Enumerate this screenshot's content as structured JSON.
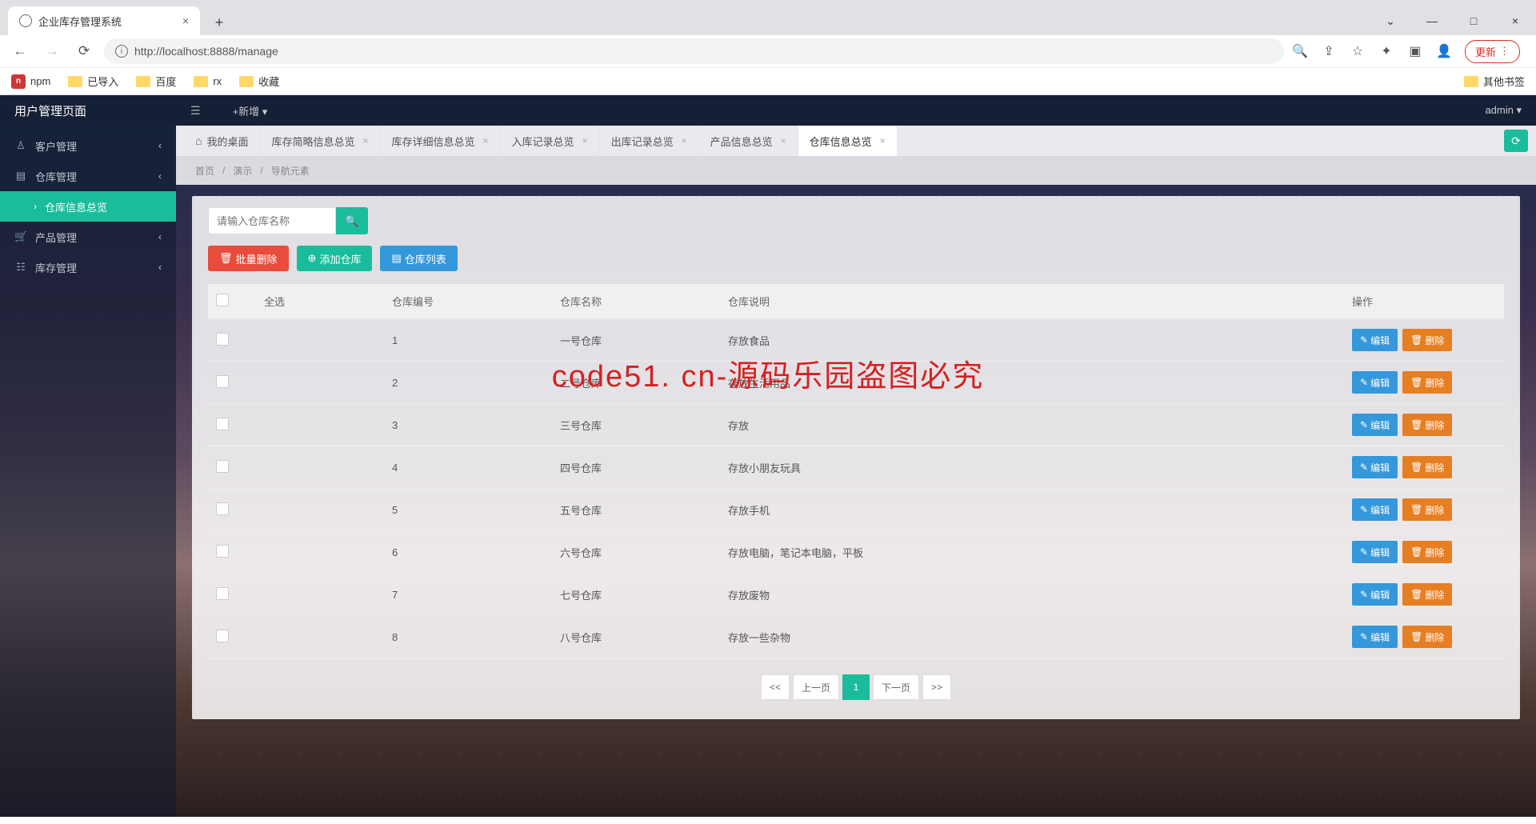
{
  "browser": {
    "tab_title": "企业库存管理系统",
    "url": "http://localhost:8888/manage",
    "update_label": "更新",
    "bookmarks": [
      {
        "label": "npm",
        "color": "#cb3837"
      },
      {
        "label": "已导入",
        "folder": true
      },
      {
        "label": "百度",
        "folder": true
      },
      {
        "label": "rx",
        "folder": true
      },
      {
        "label": "收藏",
        "folder": true
      }
    ],
    "other_bookmarks": "其他书签",
    "win": {
      "restore_down": "v"
    }
  },
  "app": {
    "title": "用户管理页面",
    "add_new": "+新增",
    "user": "admin"
  },
  "sidebar": {
    "items": [
      {
        "icon": "user-icon",
        "label": "客户管理"
      },
      {
        "icon": "warehouse-icon",
        "label": "仓库管理",
        "expanded": true
      },
      {
        "icon": "product-icon",
        "label": "产品管理"
      },
      {
        "icon": "inventory-icon",
        "label": "库存管理"
      }
    ],
    "sub_item": "仓库信息总览"
  },
  "tabs": [
    {
      "label": "我的桌面",
      "home": true
    },
    {
      "label": "库存简略信息总览"
    },
    {
      "label": "库存详细信息总览"
    },
    {
      "label": "入库记录总览"
    },
    {
      "label": "出库记录总览"
    },
    {
      "label": "产品信息总览"
    },
    {
      "label": "仓库信息总览",
      "active": true
    }
  ],
  "breadcrumb": [
    "首页",
    "演示",
    "导航元素"
  ],
  "search": {
    "placeholder": "请输入仓库名称"
  },
  "actions": {
    "batch_delete": "批量删除",
    "add": "添加仓库",
    "list": "仓库列表"
  },
  "table": {
    "headers": {
      "select_all": "全选",
      "id": "仓库编号",
      "name": "仓库名称",
      "desc": "仓库说明",
      "ops": "操作"
    },
    "edit_label": "编辑",
    "delete_label": "删除",
    "rows": [
      {
        "id": "1",
        "name": "一号仓库",
        "desc": "存放食品"
      },
      {
        "id": "2",
        "name": "二号仓库",
        "desc": "存放生活用品"
      },
      {
        "id": "3",
        "name": "三号仓库",
        "desc": "存放"
      },
      {
        "id": "4",
        "name": "四号仓库",
        "desc": "存放小朋友玩具"
      },
      {
        "id": "5",
        "name": "五号仓库",
        "desc": "存放手机"
      },
      {
        "id": "6",
        "name": "六号仓库",
        "desc": "存放电脑，笔记本电脑，平板"
      },
      {
        "id": "7",
        "name": "七号仓库",
        "desc": "存放废物"
      },
      {
        "id": "8",
        "name": "八号仓库",
        "desc": "存放一些杂物"
      }
    ]
  },
  "pager": {
    "first": "<<",
    "prev": "上一页",
    "current": "1",
    "next": "下一页",
    "last": ">>"
  },
  "watermark": "code51. cn-源码乐园盗图必究"
}
